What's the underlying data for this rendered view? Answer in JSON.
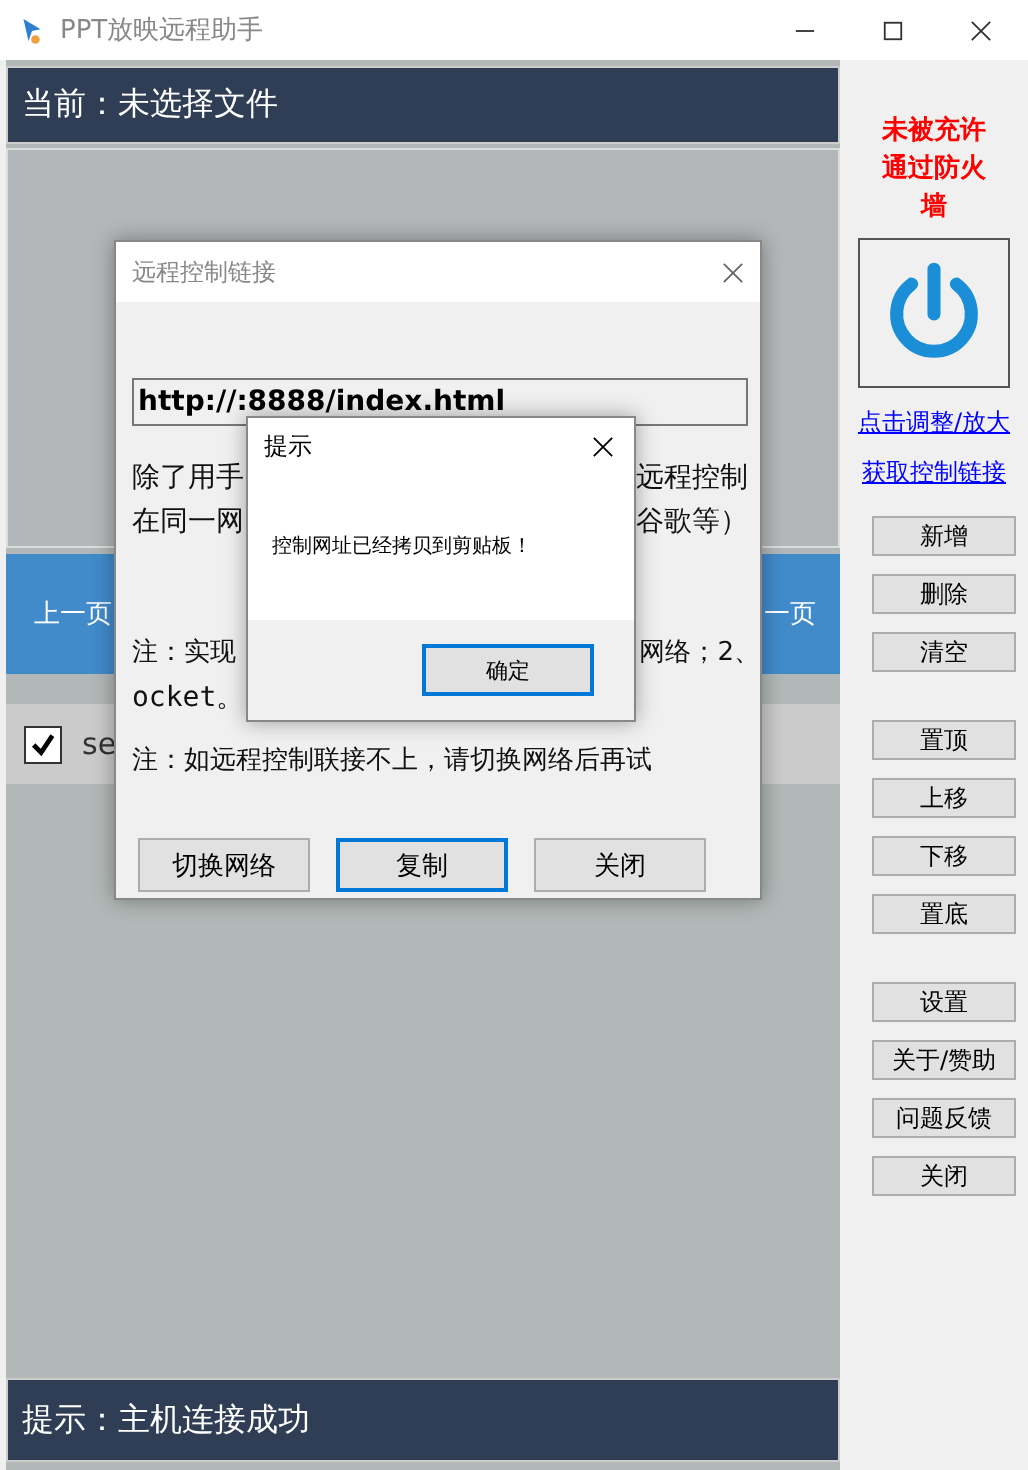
{
  "window": {
    "title": "PPT放映远程助手"
  },
  "current_file": "当前：未选择文件",
  "nav": {
    "prev": "上一页",
    "next_visible": "一页"
  },
  "list_items": [
    {
      "text": "se",
      "checked": true
    }
  ],
  "status_bar": "提示：主机连接成功",
  "sidebar": {
    "firewall_warning": "未被充许通过防火墙",
    "links": [
      "点击调整/放大",
      "获取控制链接"
    ],
    "button_groups": [
      [
        "新增",
        "删除",
        "清空"
      ],
      [
        "置顶",
        "上移",
        "下移",
        "置底"
      ],
      [
        "设置",
        "关于/赞助",
        "问题反馈",
        "关闭"
      ]
    ]
  },
  "link_dialog": {
    "title": "远程控制链接",
    "url": "http://:8888/index.html",
    "text_fragments": [
      {
        "left": "除了用手",
        "right": "远程控制"
      },
      {
        "left": "在同一网",
        "right": "谷歌等）"
      }
    ],
    "note1": {
      "left": "注：实现",
      "right": "网络；2、"
    },
    "note1_cont": "ocket。",
    "note2": "注：如远程控制联接不上，请切换网络后再试",
    "buttons": [
      {
        "label": "切换网络",
        "default": false
      },
      {
        "label": "复制",
        "default": true
      },
      {
        "label": "关闭",
        "default": false
      }
    ]
  },
  "message_box": {
    "title": "提示",
    "message": "控制网址已经拷贝到剪贴板！",
    "buttons": [
      {
        "label": "确定",
        "default": true
      }
    ]
  }
}
